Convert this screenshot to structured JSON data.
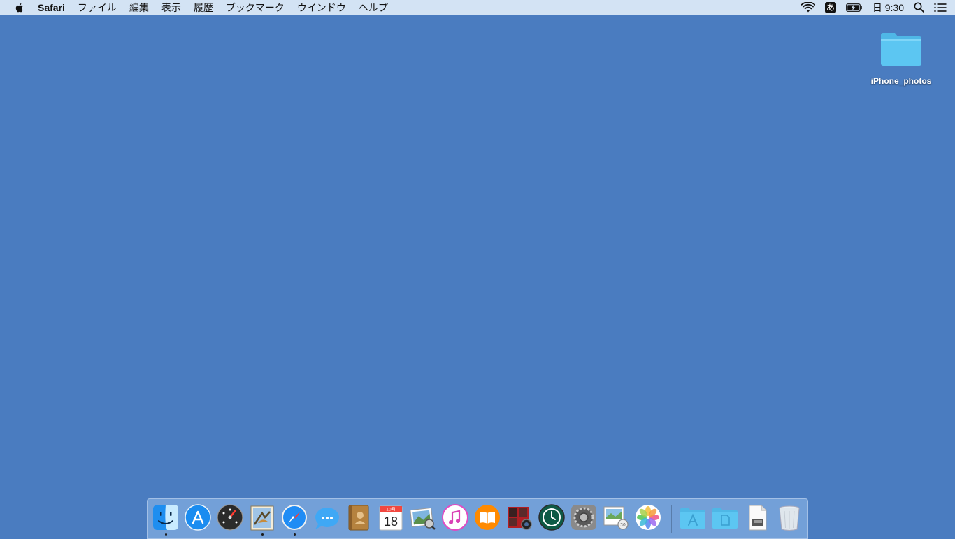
{
  "menubar": {
    "app_name": "Safari",
    "items": [
      "ファイル",
      "編集",
      "表示",
      "履歴",
      "ブックマーク",
      "ウインドウ",
      "ヘルプ"
    ],
    "input_method": "あ",
    "clock": "日 9:30"
  },
  "desktop": {
    "icons": [
      {
        "label": "iPhone_photos",
        "icon": "folder-icon"
      }
    ]
  },
  "calendar_icon": {
    "month": "10月",
    "day": "18"
  },
  "colors": {
    "desktop": "#4a7cc0",
    "menubar": "#d3e3f4",
    "folder": "#5cc6f2"
  },
  "dock": {
    "apps": [
      {
        "icon": "finder-icon",
        "running": true
      },
      {
        "icon": "app-store-icon",
        "running": false
      },
      {
        "icon": "dashboard-icon",
        "running": false
      },
      {
        "icon": "mail-icon",
        "running": true
      },
      {
        "icon": "safari-icon",
        "running": true
      },
      {
        "icon": "messages-icon",
        "running": false
      },
      {
        "icon": "contacts-icon",
        "running": false
      },
      {
        "icon": "calendar-icon",
        "running": false
      },
      {
        "icon": "preview-icon",
        "running": false
      },
      {
        "icon": "itunes-icon",
        "running": false
      },
      {
        "icon": "ibooks-icon",
        "running": false
      },
      {
        "icon": "photo-booth-icon",
        "running": false
      },
      {
        "icon": "time-machine-icon",
        "running": false
      },
      {
        "icon": "system-preferences-icon",
        "running": false
      },
      {
        "icon": "image-capture-icon",
        "running": false
      },
      {
        "icon": "photos-icon",
        "running": false
      }
    ],
    "stacks": [
      {
        "icon": "applications-folder-icon"
      },
      {
        "icon": "documents-folder-icon"
      },
      {
        "icon": "downloads-stack-icon"
      },
      {
        "icon": "trash-icon"
      }
    ]
  }
}
